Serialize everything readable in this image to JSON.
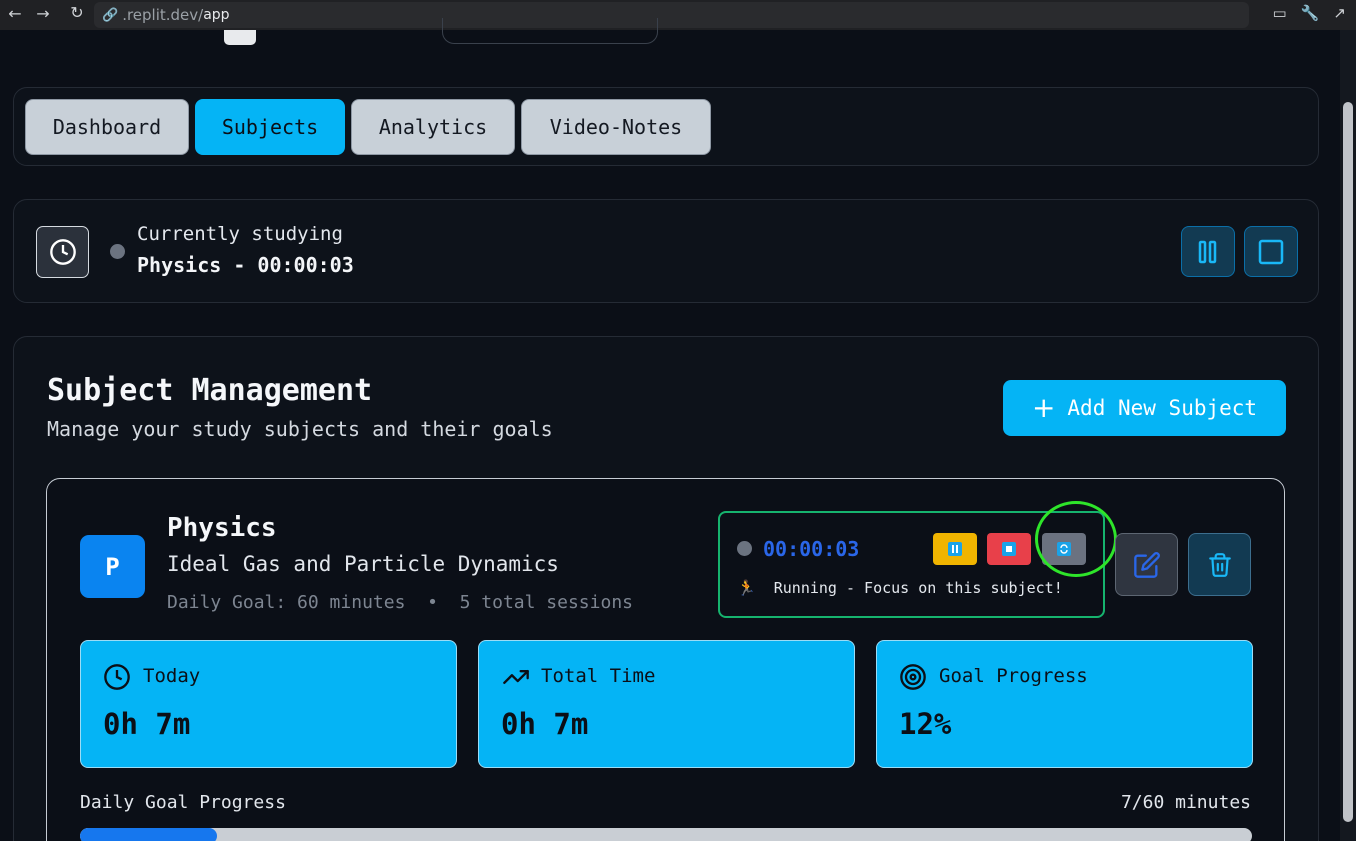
{
  "browser": {
    "url_domain": ".replit.dev/",
    "url_path": "app"
  },
  "tabs": [
    {
      "label": "Dashboard",
      "active": false
    },
    {
      "label": "Subjects",
      "active": true
    },
    {
      "label": "Analytics",
      "active": false
    },
    {
      "label": "Video-Notes",
      "active": false
    }
  ],
  "current_session": {
    "label": "Currently studying",
    "value": "Physics - 00:00:03"
  },
  "management": {
    "title": "Subject Management",
    "subtitle": "Manage your study subjects and their goals",
    "add_button": "Add New Subject"
  },
  "subject": {
    "initial": "P",
    "name": "Physics",
    "description": "Ideal Gas and Particle Dynamics",
    "meta": "Daily Goal: 60 minutes  •  5 total sessions",
    "timer": "00:00:03",
    "timer_message": "Running - Focus on this subject!",
    "timer_emoji": "🏃",
    "stats": [
      {
        "label": "Today",
        "value": "0h 7m",
        "icon": "clock-icon"
      },
      {
        "label": "Total Time",
        "value": "0h 7m",
        "icon": "trending-up-icon"
      },
      {
        "label": "Goal Progress",
        "value": "12%",
        "icon": "target-icon"
      }
    ],
    "goal_label": "Daily Goal Progress",
    "goal_count": "7/60 minutes",
    "goal_fraction": 0.117
  },
  "colors": {
    "accent": "#05b4f5",
    "background": "#0b0f17",
    "pause": "#f0b400",
    "stop": "#e8404a",
    "reset": "#6b7280",
    "annotation": "#2ee52a"
  }
}
